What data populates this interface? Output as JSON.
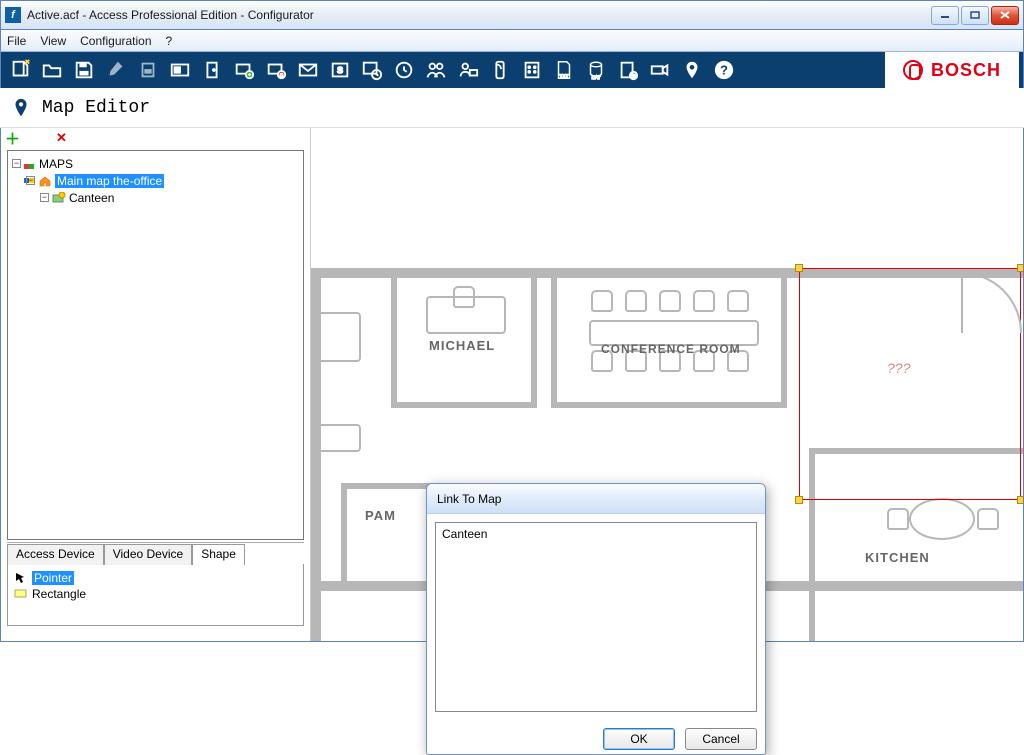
{
  "window": {
    "title": "Active.acf - Access Professional Edition - Configurator"
  },
  "menu": {
    "file": "File",
    "view": "View",
    "config": "Configuration",
    "help": "?"
  },
  "brand": "BOSCH",
  "page": {
    "title": "Map Editor"
  },
  "tree": {
    "root": "MAPS",
    "items": [
      {
        "label": "Main map the-office",
        "selected": true
      },
      {
        "label": "Canteen",
        "selected": false
      }
    ]
  },
  "tabs": {
    "access": "Access Device",
    "video": "Video Device",
    "shape": "Shape"
  },
  "shapes": {
    "pointer": "Pointer",
    "rectangle": "Rectangle"
  },
  "floorplan": {
    "room_michael": "MICHAEL",
    "room_conference": "CONFERENCE ROOM",
    "room_pam": "PAM",
    "room_kitchen": "KITCHEN",
    "placeholder": "???"
  },
  "dialog": {
    "title": "Link To Map",
    "item": "Canteen",
    "ok": "OK",
    "cancel": "Cancel"
  }
}
